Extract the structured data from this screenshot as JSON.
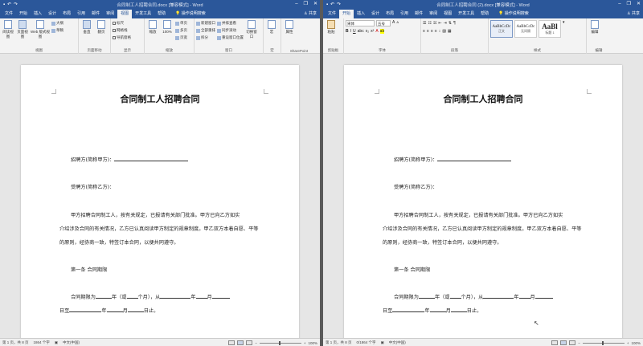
{
  "left": {
    "title": "合同制工人招聘合同.docx [兼容模式] - Word",
    "tabs": [
      "文件",
      "开始",
      "插入",
      "设计",
      "布局",
      "引用",
      "邮件",
      "审阅",
      "视图",
      "开发工具",
      "帮助"
    ],
    "active_tab": "视图",
    "tell_me": "操作说明搜索",
    "share": "共享",
    "ribbon": {
      "views": {
        "label": "视图",
        "read_mode": "阅读视图",
        "print_layout": "页面视图",
        "web_layout": "Web 版式视图",
        "outline": "大纲",
        "draft": "草稿"
      },
      "page_move": {
        "label": "页面移动",
        "vertical": "垂直",
        "side": "翻页"
      },
      "show": {
        "label": "显示",
        "ruler": "标尺",
        "gridlines": "网格线",
        "nav_pane": "导航窗格"
      },
      "zoom": {
        "label": "缩放",
        "zoom": "缩放",
        "hundred": "100%",
        "one_page": "单页",
        "multi_page": "多页",
        "page_width": "页宽"
      },
      "window": {
        "label": "窗口",
        "new_window": "新建窗口",
        "arrange_all": "全部重排",
        "split": "拆分",
        "side_by_side": "并排查看",
        "sync_scroll": "同步滚动",
        "reset_pos": "重设窗口位置",
        "switch": "切换窗口"
      },
      "macros": {
        "label": "宏",
        "macros": "宏"
      },
      "sharepoint": {
        "label": "SharePoint",
        "properties": "属性"
      }
    },
    "status": {
      "page": "第 1 页，共 8 页",
      "words": "1864 个字",
      "lang": "中文(中国)",
      "zoom": "100%"
    }
  },
  "right": {
    "title": "合同制工人招聘合同 (2).docx [兼容模式] - Word",
    "tabs": [
      "文件",
      "开始",
      "插入",
      "设计",
      "布局",
      "引用",
      "邮件",
      "审阅",
      "视图",
      "开发工具",
      "帮助"
    ],
    "active_tab": "开始",
    "tell_me": "操作说明搜索",
    "share": "共享",
    "ribbon": {
      "clipboard": {
        "label": "剪贴板",
        "paste": "粘贴"
      },
      "font": {
        "label": "字体",
        "font_name": "宋体",
        "font_size": "五号",
        "bold": "B",
        "italic": "I",
        "underline": "U"
      },
      "paragraph": {
        "label": "段落"
      },
      "styles": {
        "label": "样式",
        "items": [
          {
            "sample": "AaBbCcDc",
            "name": "正文"
          },
          {
            "sample": "AaBbCcDc",
            "name": "无间隔"
          },
          {
            "sample": "AaBl",
            "name": "标题 1"
          }
        ]
      },
      "editing": {
        "label": "编辑",
        "edit": "编辑"
      }
    },
    "status": {
      "page": "第 1 页，共 8 页",
      "words": "0/1864 个字",
      "lang": "中文(中国)",
      "zoom": "100%"
    }
  },
  "document": {
    "title": "合同制工人招聘合同",
    "party_a": "招聘方(简称甲方)：",
    "party_b": "受聘方(简称乙方)：",
    "para1_l1": "甲方招聘合同制工人，按有关规定，已报请有关部门批准。甲方已向乙方如实",
    "para1_l2": "介绍涉及合同的有关情况，乙方已认真阅读甲方制定的规章制度。甲乙双方本着自愿、平等",
    "para1_l3": "的原则，经协商一致，特签订本合同，以便共同遵守。",
    "article1": "第一条 合同期限",
    "term_l1_a": "合同期限为",
    "term_l1_b": "年（或",
    "term_l1_c": "个月），从",
    "term_l1_d": "年",
    "term_l1_e": "月",
    "term_l2_a": "日至",
    "term_l2_b": "年",
    "term_l2_c": "月",
    "term_l2_d": "日止。"
  }
}
